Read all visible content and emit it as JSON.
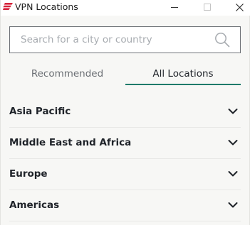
{
  "window": {
    "title": "VPN Locations",
    "logo_icon": "expressvpn-logo-icon",
    "controls": [
      "minimize-icon",
      "maximize-icon",
      "close-icon"
    ]
  },
  "search": {
    "placeholder": "Search for a city or country",
    "value": "",
    "icon": "search-icon"
  },
  "tabs": {
    "items": [
      {
        "label": "Recommended",
        "active": false
      },
      {
        "label": "All Locations",
        "active": true
      }
    ],
    "active_color": "#1f7a6a"
  },
  "regions": [
    {
      "label": "Asia Pacific",
      "icon": "chevron-down-icon"
    },
    {
      "label": "Middle East and Africa",
      "icon": "chevron-down-icon"
    },
    {
      "label": "Europe",
      "icon": "chevron-down-icon"
    },
    {
      "label": "Americas",
      "icon": "chevron-down-icon"
    }
  ],
  "colors": {
    "brand": "#d5233a",
    "background": "#f7f7f5",
    "text": "#1f2329",
    "muted_text": "#6b6f74"
  }
}
